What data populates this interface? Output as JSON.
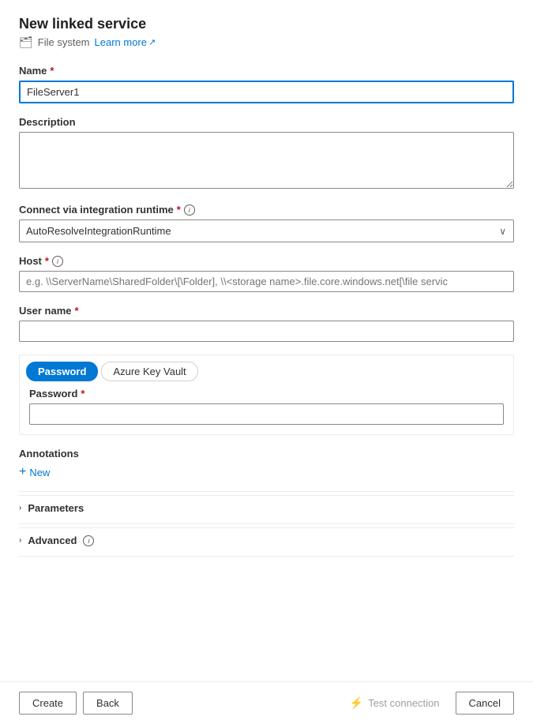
{
  "header": {
    "title": "New linked service",
    "subtitle": "File system",
    "learn_more": "Learn more",
    "external_icon": "↗"
  },
  "form": {
    "name_label": "Name",
    "name_value": "FileServer1",
    "description_label": "Description",
    "description_placeholder": "",
    "runtime_label": "Connect via integration runtime",
    "runtime_value": "AutoResolveIntegrationRuntime",
    "runtime_options": [
      "AutoResolveIntegrationRuntime"
    ],
    "host_label": "Host",
    "host_placeholder": "e.g. \\\\ServerName\\SharedFolder\\[\\Folder], \\\\<storage name>.file.core.windows.net[\\file servic",
    "username_label": "User name",
    "username_value": "",
    "password_tab_active": "Password",
    "password_tab_inactive": "Azure Key Vault",
    "password_label": "Password",
    "password_value": ""
  },
  "annotations": {
    "title": "Annotations",
    "new_label": "New"
  },
  "collapsibles": [
    {
      "label": "Parameters"
    },
    {
      "label": "Advanced"
    }
  ],
  "advanced_info_tooltip": "ⓘ",
  "footer": {
    "create_label": "Create",
    "back_label": "Back",
    "test_connection_label": "Test connection",
    "cancel_label": "Cancel"
  },
  "icons": {
    "filesystem_icon": "🗂",
    "chevron_down": "∨",
    "chevron_right": ">",
    "plus": "+",
    "info": "i",
    "test_icon": "⚡"
  },
  "colors": {
    "accent": "#0078d4",
    "required": "#c50f1f",
    "border": "#8a8886",
    "light_border": "#edebe9"
  }
}
